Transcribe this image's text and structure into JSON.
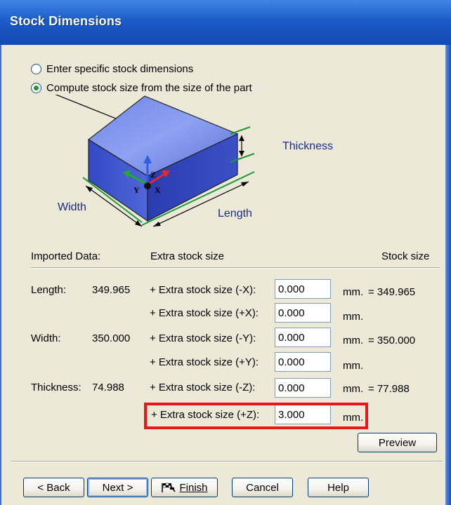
{
  "window": {
    "title": "Stock Dimensions"
  },
  "options": {
    "specific": "Enter specific stock dimensions",
    "compute": "Compute stock size from the size of the part",
    "selected": "compute"
  },
  "diagram": {
    "thickness": "Thickness",
    "width": "Width",
    "length": "Length",
    "axis_x": "X",
    "axis_y": "Y",
    "axis_z": "Z"
  },
  "headers": {
    "imported": "Imported Data:",
    "extra": "Extra stock size",
    "stock": "Stock size"
  },
  "rows": [
    {
      "name": "Length:",
      "value": "349.965",
      "label": "+ Extra stock size (-X):",
      "input": "0.000",
      "unit": "mm.",
      "result": "= 349.965"
    },
    {
      "name": "",
      "value": "",
      "label": "+ Extra stock size (+X):",
      "input": "0.000",
      "unit": "mm.",
      "result": ""
    },
    {
      "name": "Width:",
      "value": "350.000",
      "label": "+ Extra stock size (-Y):",
      "input": "0.000",
      "unit": "mm.",
      "result": "= 350.000"
    },
    {
      "name": "",
      "value": "",
      "label": "+ Extra stock size (+Y):",
      "input": "0.000",
      "unit": "mm.",
      "result": ""
    },
    {
      "name": "Thickness:",
      "value": "74.988",
      "label": "+ Extra stock size (-Z):",
      "input": "0.000",
      "unit": "mm.",
      "result": "= 77.988"
    },
    {
      "name": "",
      "value": "",
      "label": "+ Extra stock size (+Z):",
      "input": "3.000",
      "unit": "mm.",
      "result": ""
    }
  ],
  "buttons": {
    "preview": "Preview",
    "back": "< Back",
    "next": "Next >",
    "finish": "Finish",
    "cancel": "Cancel",
    "help": "Help"
  },
  "colors": {
    "title_bar": "#1d5cc9",
    "highlight": "#e8161b",
    "dim_label": "#1a2d8a"
  }
}
